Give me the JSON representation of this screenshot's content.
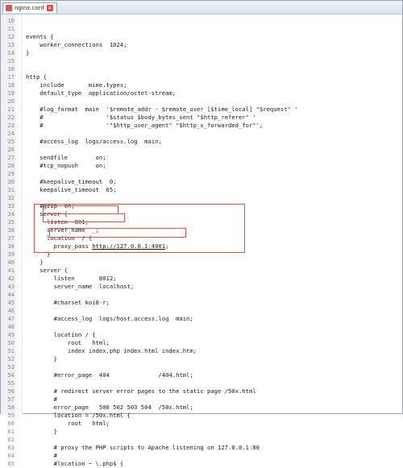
{
  "tab": {
    "label": "nginx.conf"
  },
  "colors": {
    "highlight": "#e05252"
  },
  "lines": [
    {
      "n": "10",
      "t": ""
    },
    {
      "n": "11",
      "t": ""
    },
    {
      "n": "12",
      "t": "events {"
    },
    {
      "n": "13",
      "t": "    worker_connections  1024;"
    },
    {
      "n": "14",
      "t": "}"
    },
    {
      "n": "15",
      "t": ""
    },
    {
      "n": "16",
      "t": ""
    },
    {
      "n": "17",
      "t": "http {"
    },
    {
      "n": "18",
      "t": "    include       mime.types;"
    },
    {
      "n": "19",
      "t": "    default_type  application/octet-stream;"
    },
    {
      "n": "20",
      "t": ""
    },
    {
      "n": "21",
      "t": "    #log_format  main  '$remote_addr - $remote_user [$time_local] \"$request\" '"
    },
    {
      "n": "22",
      "t": "    #                  '$status $body_bytes_sent \"$http_referer\" '"
    },
    {
      "n": "23",
      "t": "    #                  '\"$http_user_agent\" \"$http_x_forwarded_for\"';"
    },
    {
      "n": "24",
      "t": ""
    },
    {
      "n": "25",
      "t": "    #access_log  logs/access.log  main;"
    },
    {
      "n": "26",
      "t": ""
    },
    {
      "n": "27",
      "t": "    sendfile        on;"
    },
    {
      "n": "28",
      "t": "    #tcp_nopush     on;"
    },
    {
      "n": "29",
      "t": ""
    },
    {
      "n": "30",
      "t": "    #keepalive_timeout  0;"
    },
    {
      "n": "31",
      "t": "    keepalive_timeout  65;"
    },
    {
      "n": "32",
      "t": ""
    },
    {
      "n": "33",
      "t": "    #gzip  on;"
    },
    {
      "n": "34",
      "t": "    server {"
    },
    {
      "n": "35",
      "t": "      listen  801;"
    },
    {
      "n": "36",
      "t": "      server_name  _;"
    },
    {
      "n": "37",
      "t": "      location  / {"
    },
    {
      "n": "38",
      "t": "        proxy_pass http://127.0.0.1:4001;"
    },
    {
      "n": "39",
      "t": "      }"
    },
    {
      "n": "40",
      "t": "    }"
    },
    {
      "n": "41",
      "t": "    server {"
    },
    {
      "n": "42",
      "t": "        listen       8012;"
    },
    {
      "n": "43",
      "t": "        server_name  localhost;"
    },
    {
      "n": "44",
      "t": ""
    },
    {
      "n": "45",
      "t": "        #charset koi8-r;"
    },
    {
      "n": "46",
      "t": ""
    },
    {
      "n": "47",
      "t": "        #access_log  logs/host.access.log  main;"
    },
    {
      "n": "48",
      "t": ""
    },
    {
      "n": "49",
      "t": "        location / {"
    },
    {
      "n": "50",
      "t": "            root   html;"
    },
    {
      "n": "51",
      "t": "            index index.php index.html index.htm;"
    },
    {
      "n": "52",
      "t": "        }"
    },
    {
      "n": "53",
      "t": ""
    },
    {
      "n": "54",
      "t": "        #error_page  404              /404.html;"
    },
    {
      "n": "55",
      "t": ""
    },
    {
      "n": "56",
      "t": "        # redirect server error pages to the static page /50x.html"
    },
    {
      "n": "57",
      "t": "        #"
    },
    {
      "n": "58",
      "t": "        error_page   500 502 503 504  /50x.html;"
    },
    {
      "n": "59",
      "t": "        location = /50x.html {"
    },
    {
      "n": "60",
      "t": "            root   html;"
    },
    {
      "n": "61",
      "t": "        }"
    },
    {
      "n": "62",
      "t": ""
    },
    {
      "n": "63",
      "t": "        # proxy the PHP scripts to Apache listening on 127.0.0.1:80"
    },
    {
      "n": "64",
      "t": "        #"
    },
    {
      "n": "65",
      "t": "        #location ~ \\.php$ {"
    }
  ]
}
